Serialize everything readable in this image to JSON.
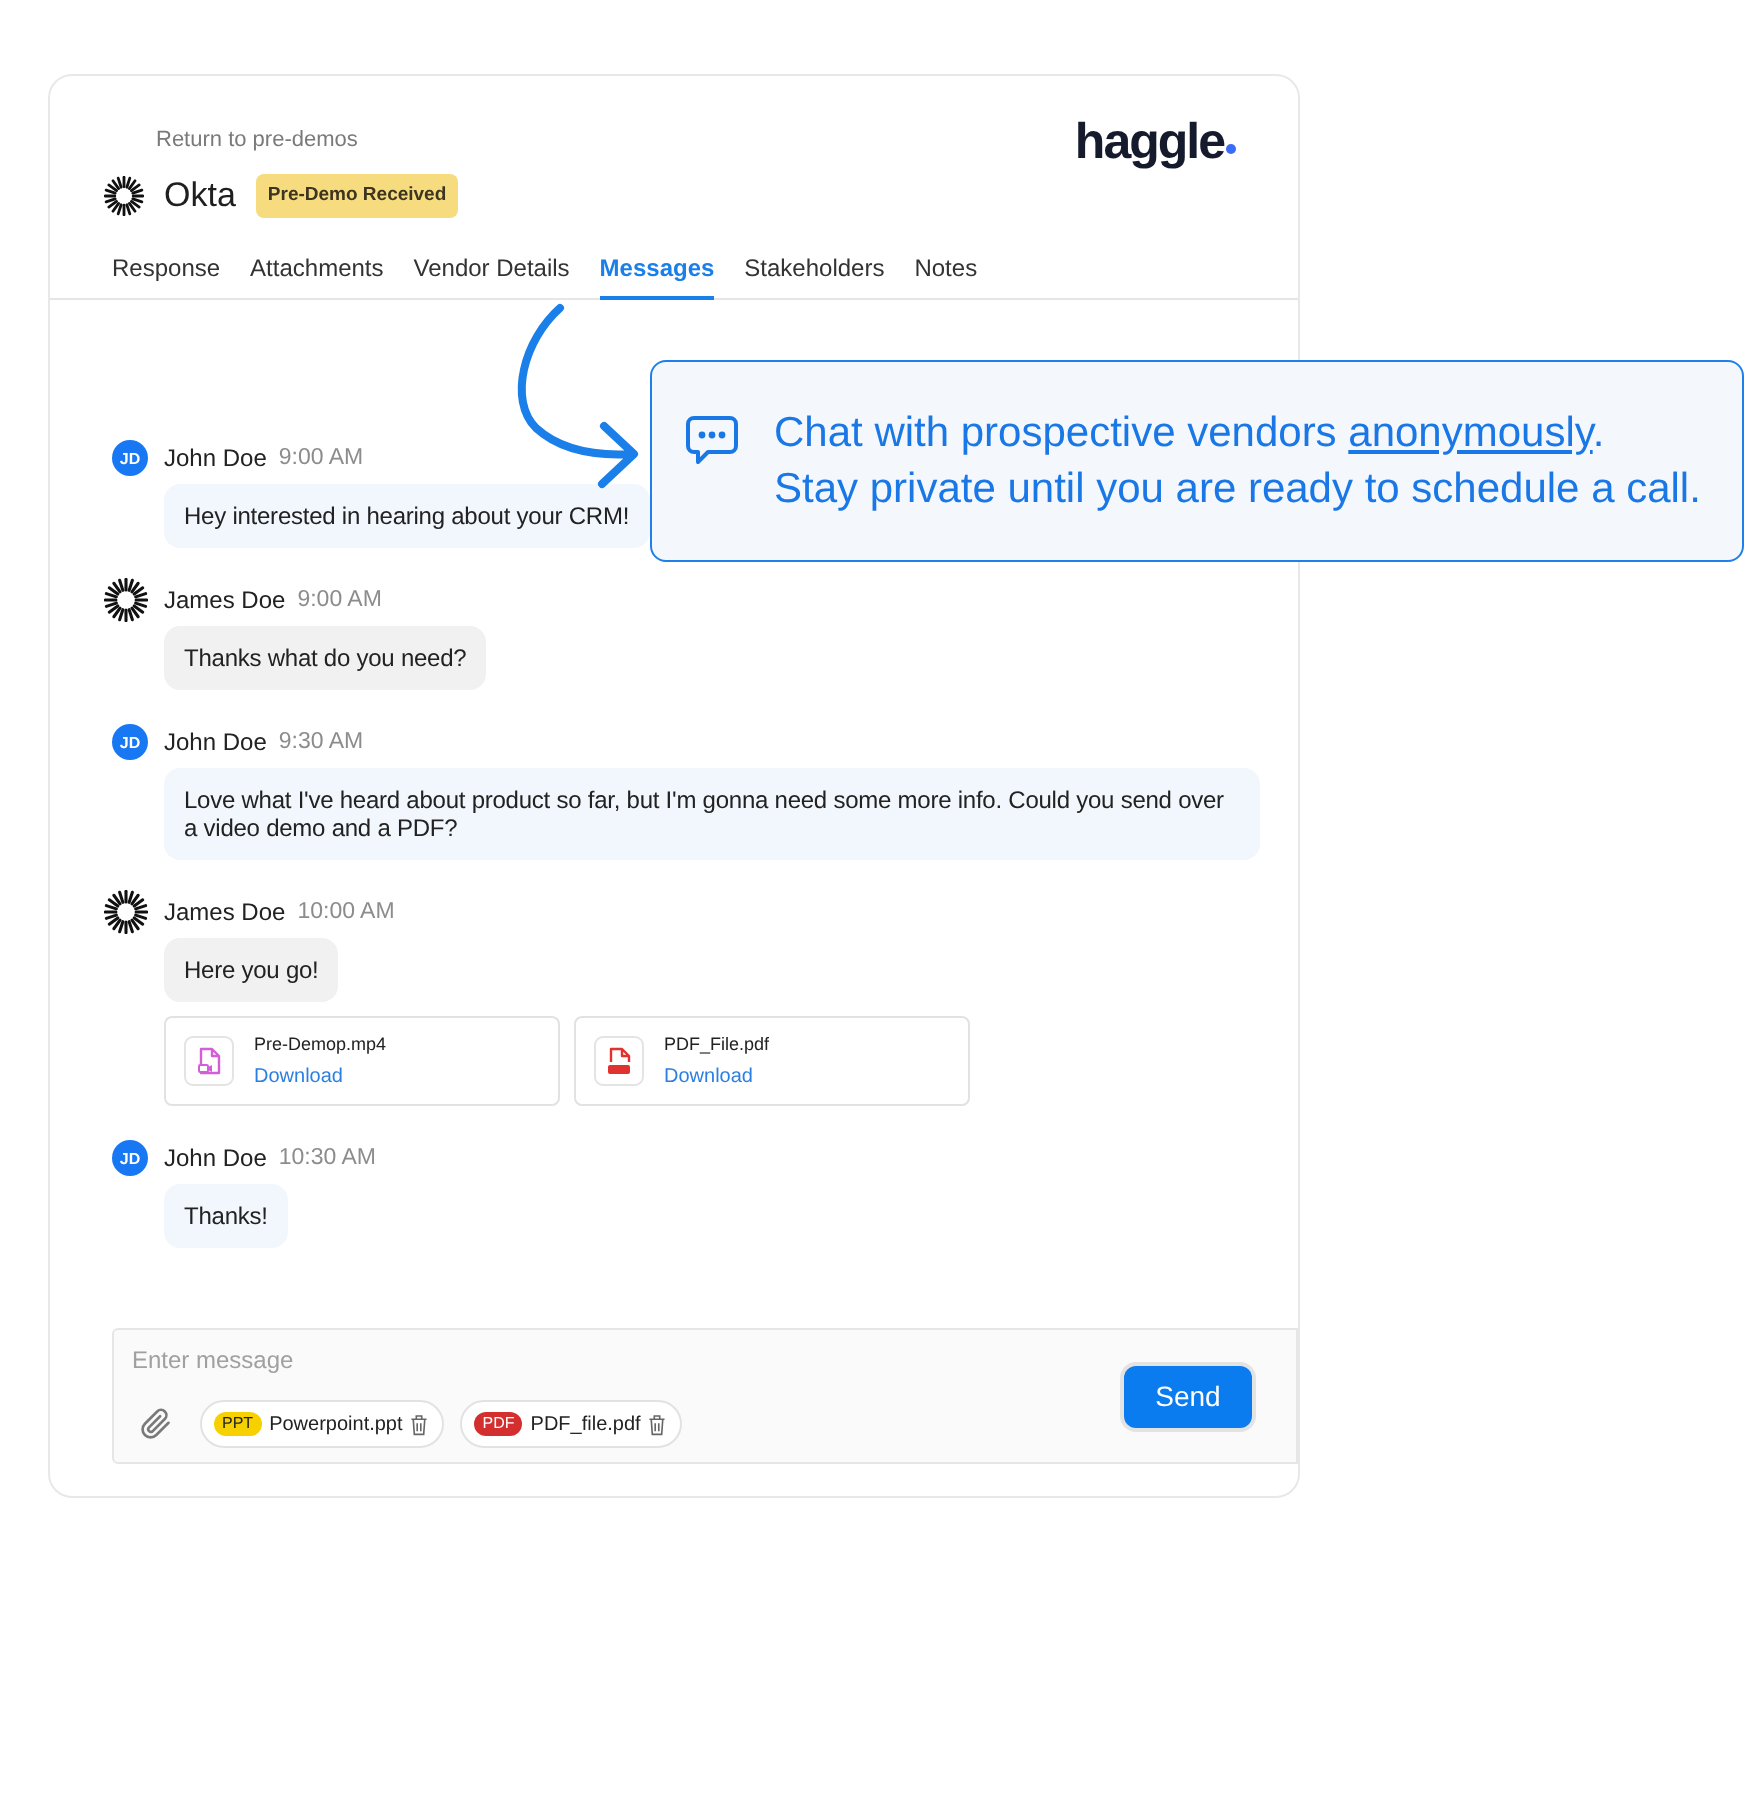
{
  "header": {
    "back_link": "Return to pre-demos",
    "logo": "haggle",
    "company": "Okta",
    "status": "Pre-Demo Received"
  },
  "tabs": [
    {
      "label": "Response",
      "selected": false
    },
    {
      "label": "Attachments",
      "selected": false
    },
    {
      "label": "Vendor Details",
      "selected": false
    },
    {
      "label": "Messages",
      "selected": true
    },
    {
      "label": "Stakeholders",
      "selected": false
    },
    {
      "label": "Notes",
      "selected": false
    }
  ],
  "messages": [
    {
      "kind": "buyer",
      "initials": "JD",
      "author": "John Doe",
      "time": "9:00 AM",
      "text": "Hey interested in hearing about your CRM!"
    },
    {
      "kind": "vendor",
      "author": "James Doe",
      "time": "9:00 AM",
      "text": "Thanks what do you need?"
    },
    {
      "kind": "buyer",
      "initials": "JD",
      "author": "John Doe",
      "time": "9:30 AM",
      "text": "Love what I've heard about product so far, but I'm gonna need some more info. Could you send over a video demo and a PDF?"
    },
    {
      "kind": "vendor",
      "author": "James Doe",
      "time": "10:00 AM",
      "text": "Here you go!",
      "attachments": [
        {
          "kind": "video",
          "name": "Pre-Demop.mp4",
          "action": "Download"
        },
        {
          "kind": "pdf",
          "name": "PDF_File.pdf",
          "action": "Download"
        }
      ]
    },
    {
      "kind": "buyer",
      "initials": "JD",
      "author": "John Doe",
      "time": "10:30 AM",
      "text": "Thanks!"
    }
  ],
  "composer": {
    "placeholder": "Enter message",
    "files": [
      {
        "tag": "PPT",
        "color": "#f7d000",
        "name": "Powerpoint.ppt"
      },
      {
        "tag": "PDF",
        "color": "#d32f2f",
        "name": "PDF_file.pdf"
      }
    ],
    "send": "Send"
  },
  "callout": {
    "lead": "Chat with prospective vendors",
    "link": "anonymously",
    "end": ".",
    "line_2": "Stay private until you are ready to schedule a call."
  }
}
